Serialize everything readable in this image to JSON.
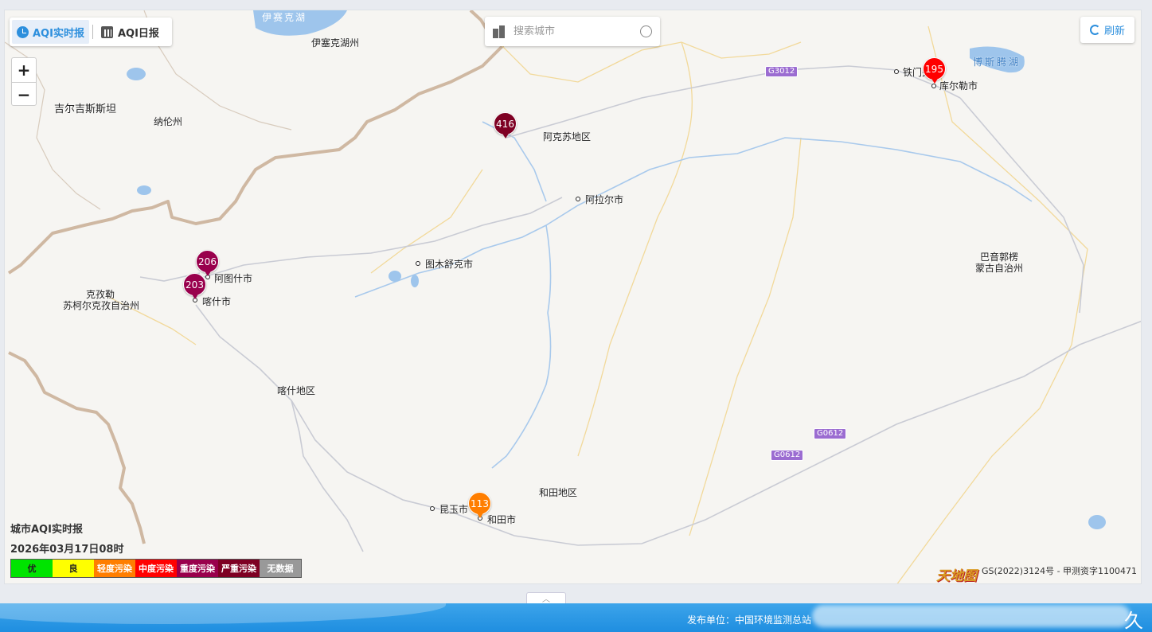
{
  "toolbar": {
    "realtime_label": "AQI实时报",
    "daily_label": "AQI日报",
    "search_placeholder": "搜索城市",
    "refresh_label": "刷新",
    "zoom_in": "+",
    "zoom_out": "−"
  },
  "map_labels": {
    "lake_yisaike": "伊赛克湖",
    "yisaike_province": "伊塞克湖州",
    "kyrgyzstan": "吉尔吉斯斯坦",
    "naryn": "纳伦州",
    "akesu": "阿克苏地区",
    "alaer": "阿拉尔市",
    "tumushuke": "图木舒克市",
    "atushi": "阿图什市",
    "kashi_city": "喀什市",
    "kezilesu_1": "克孜勒",
    "kezilesu_2": "苏柯尔克孜自治州",
    "kashi_region": "喀什地区",
    "hetian_region": "和田地区",
    "kunyu": "昆玉市",
    "hetian_city": "和田市",
    "tiemenguan": "铁门关",
    "kuerle": "库尔勒市",
    "bosten": "博斯腾湖",
    "bayin_1": "巴音郭楞",
    "bayin_2": "蒙古自治州"
  },
  "highways": [
    "G3012",
    "G0612",
    "G0612"
  ],
  "aqi_markers": [
    {
      "city": "阿克苏",
      "aqi": "416",
      "level": "严重污染",
      "color": "#7e0023"
    },
    {
      "city": "阿图什",
      "aqi": "206",
      "level": "重度污染",
      "color": "#99004c"
    },
    {
      "city": "喀什",
      "aqi": "203",
      "level": "重度污染",
      "color": "#99004c"
    },
    {
      "city": "库尔勒",
      "aqi": "195",
      "level": "中度污染",
      "color": "#ff0000"
    },
    {
      "city": "和田",
      "aqi": "113",
      "level": "轻度污染",
      "color": "#ff7e00"
    }
  ],
  "legend": {
    "title": "城市AQI实时报",
    "time": "2026年03月17日08时",
    "levels": [
      {
        "label": "优",
        "color": "#00e400",
        "text_color": "#222"
      },
      {
        "label": "良",
        "color": "#ffff00",
        "text_color": "#222"
      },
      {
        "label": "轻度污染",
        "color": "#ff7e00",
        "text_color": "#fff"
      },
      {
        "label": "中度污染",
        "color": "#ff0000",
        "text_color": "#fff"
      },
      {
        "label": "重度污染",
        "color": "#99004c",
        "text_color": "#fff"
      },
      {
        "label": "严重污染",
        "color": "#7e0023",
        "text_color": "#fff"
      },
      {
        "label": "无数据",
        "color": "#999999",
        "text_color": "#fff"
      }
    ]
  },
  "attribution": {
    "logo": "天地图",
    "copyright": "GS(2022)3124号 - 甲测资字1100471"
  },
  "footer": {
    "publisher": "发布单位：中国环境监测总站",
    "corner": "久"
  },
  "colors": {
    "accent": "#2d8fdd",
    "footer": "#2a98e4"
  }
}
